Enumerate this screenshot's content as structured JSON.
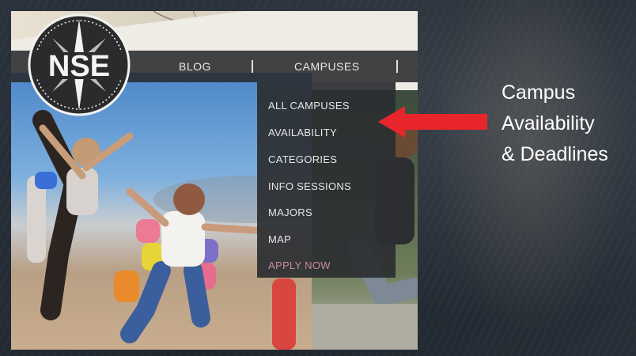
{
  "nav": {
    "blog_label": "BLOG",
    "campuses_label": "CAMPUSES"
  },
  "logo": {
    "text": "NSE"
  },
  "dropdown": {
    "items": [
      {
        "label": "ALL CAMPUSES"
      },
      {
        "label": "AVAILABILITY"
      },
      {
        "label": "CATEGORIES"
      },
      {
        "label": "INFO SESSIONS"
      },
      {
        "label": "MAJORS"
      },
      {
        "label": "MAP"
      },
      {
        "label": "APPLY NOW"
      }
    ]
  },
  "callout": {
    "line1": "Campus",
    "line2": "Availability",
    "line3": "& Deadlines"
  },
  "colors": {
    "arrow": "#e8252b",
    "apply_now": "#c98aa0",
    "nav_bg": "#2a2c30",
    "background": "#1f262e"
  },
  "icons": [
    "compass-star-icon",
    "arrow-left-icon"
  ]
}
